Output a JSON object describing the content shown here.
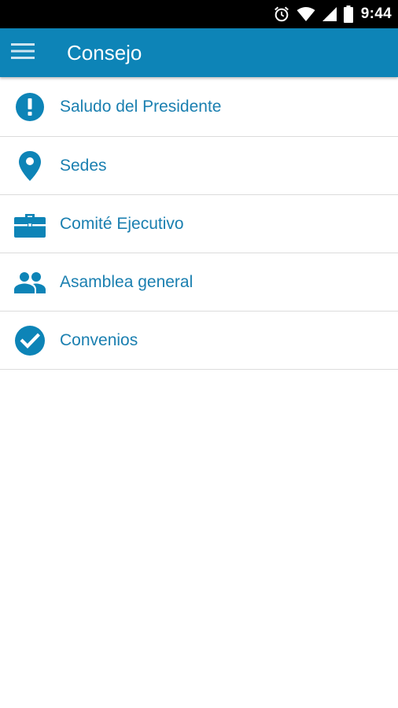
{
  "status_bar": {
    "time": "9:44",
    "icons": [
      "alarm-icon",
      "wifi-icon",
      "signal-icon",
      "battery-icon"
    ]
  },
  "app_bar": {
    "title": "Consejo",
    "menu_icon": "hamburger-menu-icon"
  },
  "colors": {
    "primary": "#0d84b7",
    "accent_text": "#1a7fb0",
    "divider": "#dcdcdc"
  },
  "menu": {
    "items": [
      {
        "label": "Saludo del Presidente",
        "icon": "exclamation-circle-icon"
      },
      {
        "label": "Sedes",
        "icon": "location-pin-icon"
      },
      {
        "label": "Comité Ejecutivo",
        "icon": "briefcase-icon"
      },
      {
        "label": "Asamblea general",
        "icon": "people-icon"
      },
      {
        "label": "Convenios",
        "icon": "check-circle-icon"
      }
    ]
  }
}
